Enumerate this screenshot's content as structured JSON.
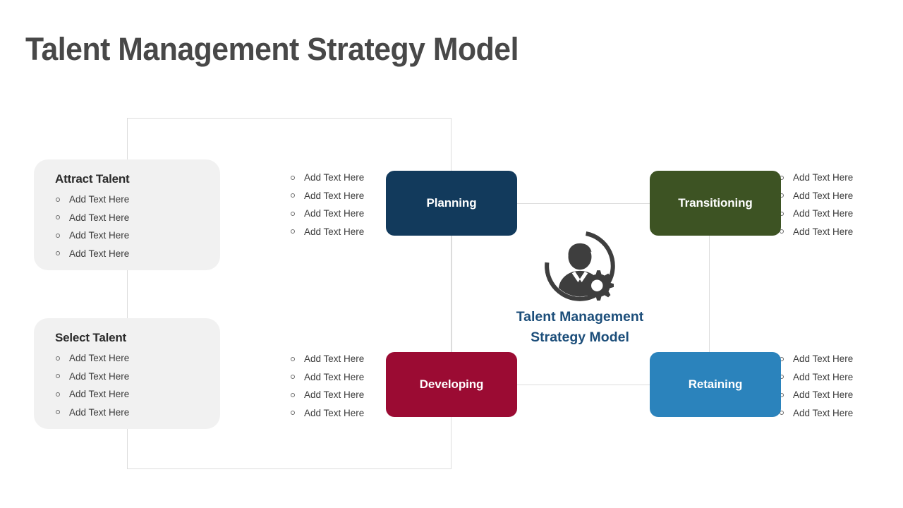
{
  "page": {
    "title": "Talent Management Strategy Model",
    "background": "#ffffff"
  },
  "colors": {
    "title_text": "#484848",
    "panel_bg": "#f1f1f1",
    "line": "#dcdcdc",
    "planning": "#123a5c",
    "transitioning": "#3d5323",
    "developing": "#9b0b33",
    "retaining": "#2b83bc",
    "center_label": "#1c4e7a",
    "icon": "#3e3e3e"
  },
  "side_panels": [
    {
      "id": "attract-talent",
      "title": "Attract Talent",
      "bullets": [
        "Add Text Here",
        "Add Text Here",
        "Add Text Here",
        "Add Text Here"
      ]
    },
    {
      "id": "select-talent",
      "title": "Select Talent",
      "bullets": [
        "Add Text Here",
        "Add Text Here",
        "Add Text Here",
        "Add Text Here"
      ]
    }
  ],
  "bullet_columns": [
    {
      "id": "planning-bullets",
      "items": [
        "Add Text Here",
        "Add Text Here",
        "Add Text Here",
        "Add Text Here"
      ]
    },
    {
      "id": "transitioning-bullets",
      "items": [
        "Add Text Here",
        "Add Text Here",
        "Add Text Here",
        "Add Text Here"
      ]
    },
    {
      "id": "developing-bullets",
      "items": [
        "Add Text Here",
        "Add Text Here",
        "Add Text Here",
        "Add Text Here"
      ]
    },
    {
      "id": "retaining-bullets",
      "items": [
        "Add Text Here",
        "Add Text Here",
        "Add Text Here",
        "Add Text Here"
      ]
    }
  ],
  "nodes": [
    {
      "id": "planning",
      "label": "Planning",
      "color": "#123a5c"
    },
    {
      "id": "transitioning",
      "label": "Transitioning",
      "color": "#3d5323"
    },
    {
      "id": "developing",
      "label": "Developing",
      "color": "#9b0b33"
    },
    {
      "id": "retaining",
      "label": "Retaining",
      "color": "#2b83bc"
    }
  ],
  "center": {
    "icon": "person-gear-icon",
    "label_line1": "Talent Management",
    "label_line2": "Strategy Model"
  }
}
